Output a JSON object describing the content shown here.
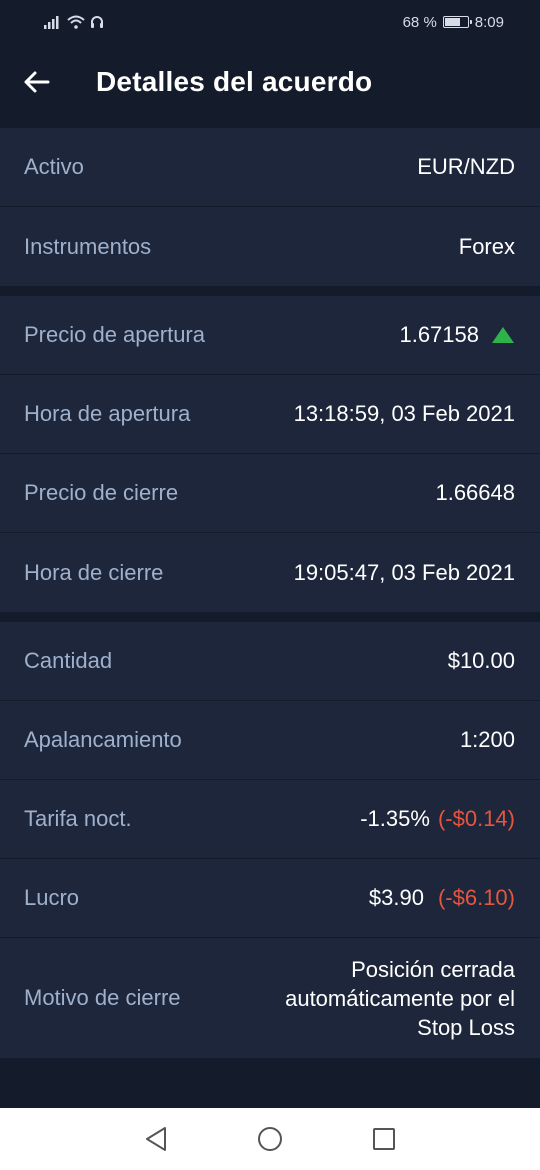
{
  "status_bar": {
    "battery_percent": "68 %",
    "battery_level": 0.68,
    "time": "8:09"
  },
  "header": {
    "title": "Detalles del acuerdo"
  },
  "sections": [
    {
      "rows": [
        {
          "label": "Activo",
          "value": "EUR/NZD"
        },
        {
          "label": "Instrumentos",
          "value": "Forex"
        }
      ]
    },
    {
      "rows": [
        {
          "label": "Precio de apertura",
          "value": "1.67158",
          "direction_icon": "triangle-up-icon"
        },
        {
          "label": "Hora de apertura",
          "value": "13:18:59, 03 Feb 2021"
        },
        {
          "label": "Precio de cierre",
          "value": "1.66648"
        },
        {
          "label": "Hora de cierre",
          "value": "19:05:47, 03 Feb 2021"
        }
      ]
    },
    {
      "rows": [
        {
          "label": "Cantidad",
          "value": "$10.00"
        },
        {
          "label": "Apalancamiento",
          "value": "1:200"
        },
        {
          "label": "Tarifa noct.",
          "value": "-1.35%",
          "value_extra": "(-$0.14)"
        },
        {
          "label": "Lucro",
          "value": "$3.90",
          "value_extra": "(-$6.10)"
        },
        {
          "label": "Motivo de cierre",
          "value": "Posición cerrada automáticamente por el Stop Loss"
        }
      ]
    }
  ],
  "colors": {
    "background": "#141c2c",
    "card": "#1d263a",
    "label": "#9fb0cd",
    "negative": "#e8553f",
    "up_green": "#2db34a"
  }
}
